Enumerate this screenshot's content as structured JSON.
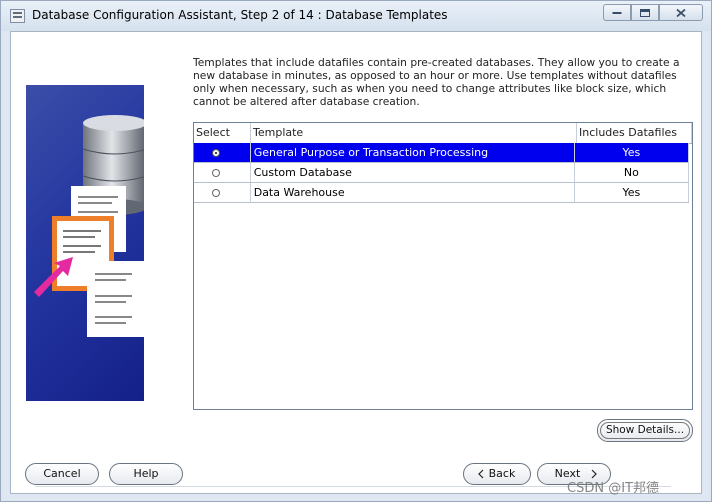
{
  "window": {
    "title": "Database Configuration Assistant, Step 2 of 14 : Database Templates"
  },
  "description": "Templates that include datafiles contain pre-created databases. They allow you to create a new database in minutes, as opposed to an hour or more. Use templates without datafiles only when necessary, such as when you need to change attributes like block size, which cannot be altered after database creation.",
  "templates_table": {
    "columns": [
      "Select",
      "Template",
      "Includes Datafiles"
    ],
    "rows": [
      {
        "template": "General Purpose or Transaction Processing",
        "includes_datafiles": "Yes",
        "selected": true
      },
      {
        "template": "Custom Database",
        "includes_datafiles": "No",
        "selected": false
      },
      {
        "template": "Data Warehouse",
        "includes_datafiles": "Yes",
        "selected": false
      }
    ]
  },
  "buttons": {
    "show_details": "Show Details...",
    "cancel": "Cancel",
    "help": "Help",
    "back": "Back",
    "next": "Next"
  },
  "watermark": "CSDN @IT邦德",
  "colors": {
    "selection": "#0000ee",
    "banner": "#2436a0",
    "window_chrome": "#dfe8f2"
  }
}
